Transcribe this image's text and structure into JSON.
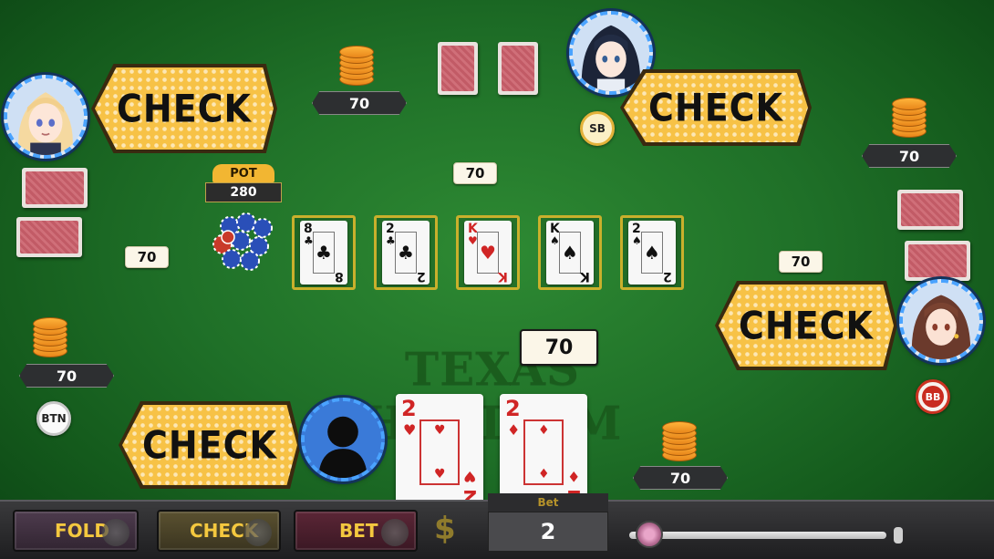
{
  "game": {
    "felt_title": "TEXAS HOLD'EM"
  },
  "players": {
    "left_top": {
      "action": "CHECK",
      "stack": "70",
      "bet": "70"
    },
    "top": {
      "action": "CHECK",
      "stack": "70",
      "bet": "70",
      "marker": "SB"
    },
    "right": {
      "action": "CHECK",
      "stack": "70",
      "bet": "70",
      "marker": "BB"
    },
    "hero": {
      "action": "CHECK",
      "stack": "70",
      "bet": "70",
      "marker": "BTN"
    }
  },
  "right_top_stack": "70",
  "pot": {
    "label": "POT",
    "value": "280"
  },
  "board": [
    {
      "rank": "8",
      "suit": "♣",
      "color": "#111111"
    },
    {
      "rank": "2",
      "suit": "♣",
      "color": "#111111"
    },
    {
      "rank": "K",
      "suit": "♥",
      "color": "#d02525"
    },
    {
      "rank": "K",
      "suit": "♠",
      "color": "#111111"
    },
    {
      "rank": "2",
      "suit": "♠",
      "color": "#111111"
    }
  ],
  "hero_cards": [
    {
      "rank": "2",
      "suit": "♥"
    },
    {
      "rank": "2",
      "suit": "♦"
    }
  ],
  "controls": {
    "fold_label": "FOLD",
    "check_label": "CHECK",
    "bet_label": "BET",
    "currency_symbol": "$",
    "bet_header": "Bet",
    "bet_amount": "2",
    "slider_level": 0.02
  },
  "colors": {
    "felt": "#1f7028",
    "bubble": "#f7c246",
    "accent_gold": "#f4c83f"
  }
}
